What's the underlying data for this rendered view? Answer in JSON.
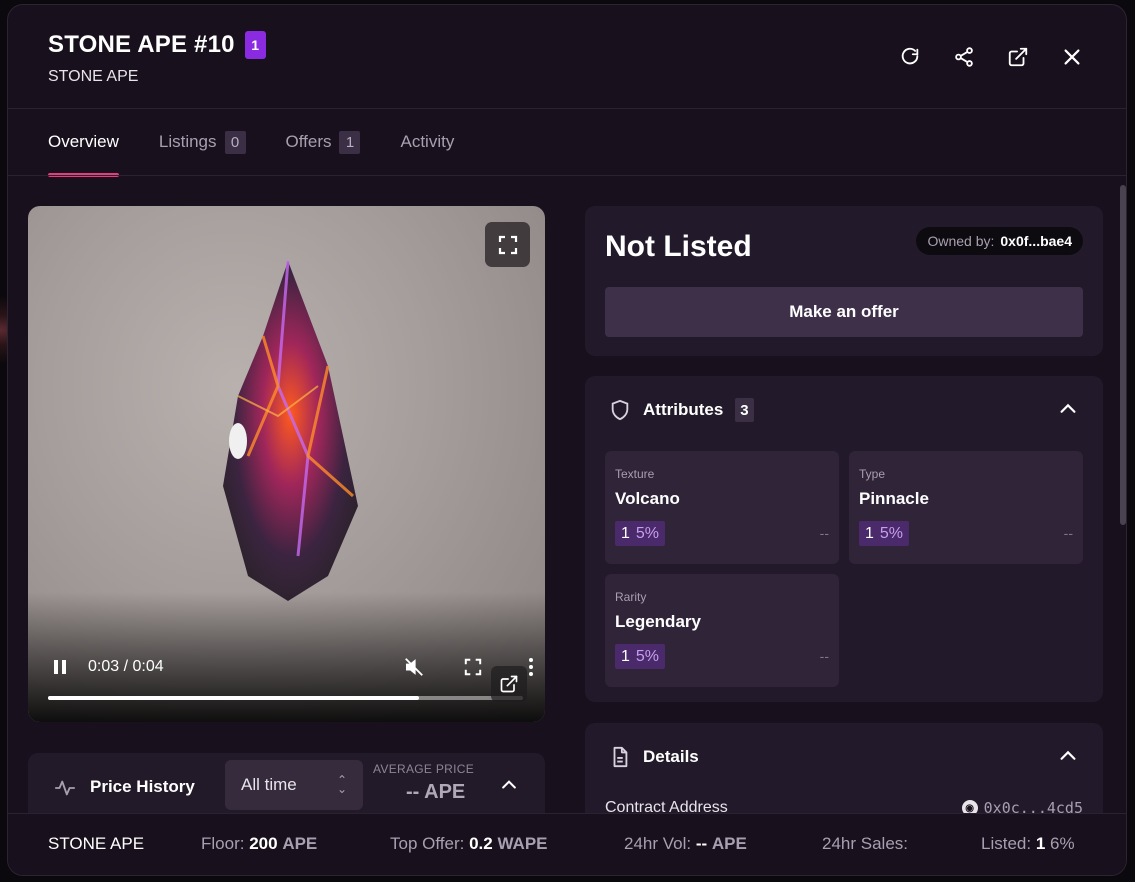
{
  "header": {
    "title": "STONE APE #10",
    "badge": "1",
    "subtitle": "STONE APE",
    "actions": [
      "refresh-icon",
      "share-icon",
      "external-link-icon",
      "close-icon"
    ]
  },
  "tabs": [
    {
      "label": "Overview",
      "count": null,
      "active": true
    },
    {
      "label": "Listings",
      "count": "0",
      "active": false
    },
    {
      "label": "Offers",
      "count": "1",
      "active": false
    },
    {
      "label": "Activity",
      "count": null,
      "active": false
    }
  ],
  "media": {
    "time": "0:03 / 0:04",
    "progress": 0.78
  },
  "price_history": {
    "label": "Price History",
    "range": "All time",
    "avg_label": "AVERAGE PRICE",
    "avg_value": "-- APE"
  },
  "listing": {
    "status": "Not Listed",
    "owner_label": "Owned by:",
    "owner_value": "0x0f...bae4",
    "offer_button": "Make an offer"
  },
  "attributes": {
    "title": "Attributes",
    "count": "3",
    "items": [
      {
        "type": "Texture",
        "value": "Volcano",
        "count": "1",
        "percent": "5%",
        "price": "--"
      },
      {
        "type": "Type",
        "value": "Pinnacle",
        "count": "1",
        "percent": "5%",
        "price": "--"
      },
      {
        "type": "Rarity",
        "value": "Legendary",
        "count": "1",
        "percent": "5%",
        "price": "--"
      }
    ]
  },
  "details": {
    "title": "Details",
    "contract_label": "Contract Address",
    "contract_value": "0x0c...4cd5"
  },
  "footer": {
    "collection": "STONE APE",
    "floor_label": "Floor:",
    "floor_value": "200",
    "floor_unit": "APE",
    "top_offer_label": "Top Offer:",
    "top_offer_value": "0.2",
    "top_offer_unit": "WAPE",
    "vol_label": "24hr Vol:",
    "vol_value": "--",
    "vol_unit": "APE",
    "sales_label": "24hr Sales:",
    "listed_label": "Listed:",
    "listed_value": "1",
    "listed_pct": "6%"
  },
  "colors": {
    "accent": "#e43d7a",
    "badge": "#8a2be2",
    "panel": "#22192a",
    "background": "#18101c"
  }
}
